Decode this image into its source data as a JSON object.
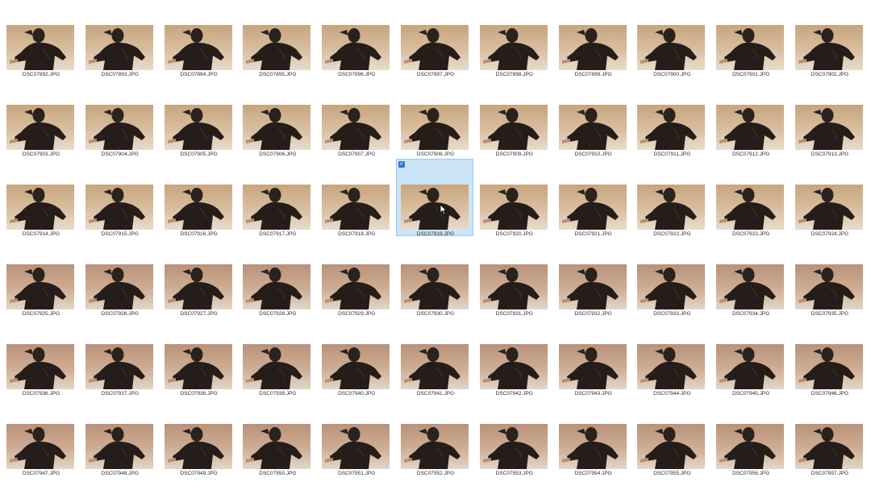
{
  "gallery": {
    "files": [
      "DSC07892.JPG",
      "DSC07893.JPG",
      "DSC07894.JPG",
      "DSC07895.JPG",
      "DSC07896.JPG",
      "DSC07897.JPG",
      "DSC07898.JPG",
      "DSC07899.JPG",
      "DSC07900.JPG",
      "DSC07901.JPG",
      "DSC07902.JPG",
      "DSC07903.JPG",
      "DSC07904.JPG",
      "DSC07905.JPG",
      "DSC07906.JPG",
      "DSC07907.JPG",
      "DSC07908.JPG",
      "DSC07909.JPG",
      "DSC07910.JPG",
      "DSC07911.JPG",
      "DSC07912.JPG",
      "DSC07913.JPG",
      "DSC07914.JPG",
      "DSC07915.JPG",
      "DSC07916.JPG",
      "DSC07917.JPG",
      "DSC07918.JPG",
      "DSC07919.JPG",
      "DSC07920.JPG",
      "DSC07921.JPG",
      "DSC07922.JPG",
      "DSC07923.JPG",
      "DSC07924.JPG",
      "DSC07925.JPG",
      "DSC07926.JPG",
      "DSC07927.JPG",
      "DSC07928.JPG",
      "DSC07929.JPG",
      "DSC07930.JPG",
      "DSC07931.JPG",
      "DSC07932.JPG",
      "DSC07933.JPG",
      "DSC07934.JPG",
      "DSC07935.JPG",
      "DSC07936.JPG",
      "DSC07937.JPG",
      "DSC07938.JPG",
      "DSC07939.JPG",
      "DSC07940.JPG",
      "DSC07941.JPG",
      "DSC07942.JPG",
      "DSC07943.JPG",
      "DSC07944.JPG",
      "DSC07945.JPG",
      "DSC07946.JPG",
      "DSC07947.JPG",
      "DSC07948.JPG",
      "DSC07949.JPG",
      "DSC07950.JPG",
      "DSC07951.JPG",
      "DSC07952.JPG",
      "DSC07953.JPG",
      "DSC07954.JPG",
      "DSC07955.JPG",
      "DSC07956.JPG",
      "DSC07957.JPG"
    ],
    "selected_file": "DSC07919.JPG",
    "selection_color": "#cce4f7",
    "checkbox_color": "#2a7ad4",
    "icons": {
      "checkbox": "checkbox-checked-icon",
      "cursor": "mouse-pointer-icon"
    }
  }
}
